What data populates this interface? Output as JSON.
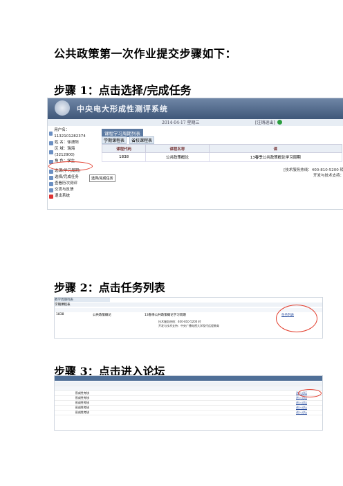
{
  "title": "公共政策第一次作业提交步骤如下：",
  "steps": [
    {
      "label": "步骤 1：点击选择/完成任务"
    },
    {
      "label": "步骤 2：点击任务列表"
    },
    {
      "label": "步骤 3：点击进入论坛"
    }
  ],
  "shot1": {
    "system_title": "中央电大形成性测评系统",
    "date": "2014-04-17 星期三",
    "exit": "[注销退出]",
    "user_fields": [
      {
        "label": "用户名：1132101282374"
      },
      {
        "label": "姓  名：徐潇阳"
      },
      {
        "label": "区  域：瑞海(3212900)"
      },
      {
        "label": "角  色：学生"
      }
    ],
    "menu": [
      {
        "label": "选课(学习周期)"
      },
      {
        "label": "选择/完成任务"
      },
      {
        "label": "查看历次测评"
      },
      {
        "label": "交流与反馈"
      },
      {
        "label": "退出系统"
      }
    ],
    "tooltip": "选择/完成任务",
    "panel_title": "课程学习周期列表",
    "tabs": [
      "学期课程表",
      "省校课程表"
    ],
    "table": {
      "headers": [
        "课程代码",
        "课程名称",
        "课"
      ],
      "rows": [
        [
          "1838",
          "公共政策概论",
          "13春季公共政策概论学习周期"
        ]
      ]
    },
    "hotline": "[技术服务热线：400-810-5200 转",
    "support": "开发与技术支持："
  },
  "shot2": {
    "header": "教学周期列表",
    "subheader": "学期课程表",
    "row": [
      "1838",
      "公共政策概论",
      "13春季公共政策概论学习周期",
      "任务列表"
    ],
    "footer1": "技术服务热线：400-810-5200 转",
    "footer2": "开发与技术支持：中央广播电视大学现代远程教育"
  },
  "shot3": {
    "rows": [
      "形成性考核",
      "形成性考核",
      "形成性考核",
      "形成性考核",
      "形成性考核"
    ],
    "link": "进入论坛"
  }
}
